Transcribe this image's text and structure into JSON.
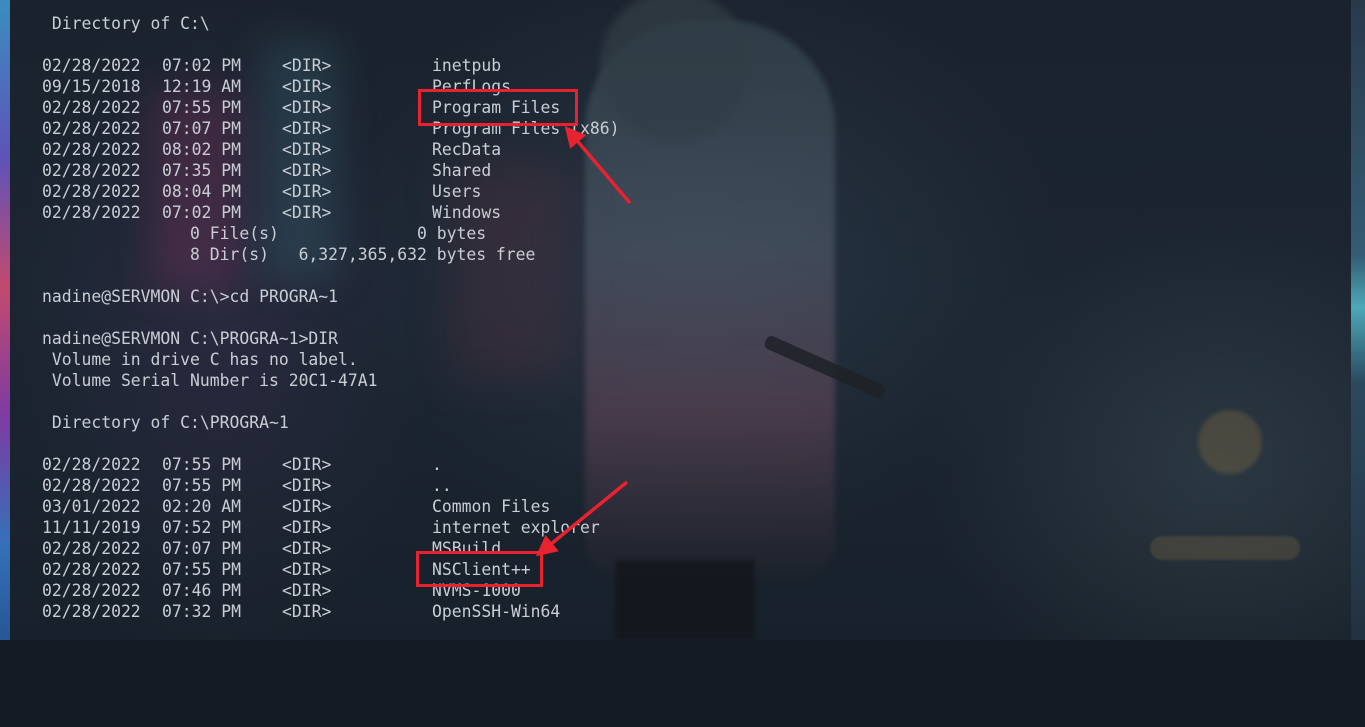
{
  "terminal": {
    "header1": " Directory of C:\\",
    "listing1": [
      {
        "date": "02/28/2022",
        "time": "07:02 PM",
        "type": "<DIR>",
        "name": "inetpub"
      },
      {
        "date": "09/15/2018",
        "time": "12:19 AM",
        "type": "<DIR>",
        "name": "PerfLogs"
      },
      {
        "date": "02/28/2022",
        "time": "07:55 PM",
        "type": "<DIR>",
        "name": "Program Files"
      },
      {
        "date": "02/28/2022",
        "time": "07:07 PM",
        "type": "<DIR>",
        "name": "Program Files (x86)"
      },
      {
        "date": "02/28/2022",
        "time": "08:02 PM",
        "type": "<DIR>",
        "name": "RecData"
      },
      {
        "date": "02/28/2022",
        "time": "07:35 PM",
        "type": "<DIR>",
        "name": "Shared"
      },
      {
        "date": "02/28/2022",
        "time": "08:04 PM",
        "type": "<DIR>",
        "name": "Users"
      },
      {
        "date": "02/28/2022",
        "time": "07:02 PM",
        "type": "<DIR>",
        "name": "Windows"
      }
    ],
    "summary_files": "               0 File(s)              0 bytes",
    "summary_dirs": "               8 Dir(s)   6,327,365,632 bytes free",
    "cmd1": "nadine@SERVMON C:\\>cd PROGRA~1",
    "cmd2": "nadine@SERVMON C:\\PROGRA~1>DIR",
    "volume_label": " Volume in drive C has no label.",
    "volume_serial": " Volume Serial Number is 20C1-47A1",
    "header2": " Directory of C:\\PROGRA~1",
    "listing2": [
      {
        "date": "02/28/2022",
        "time": "07:55 PM",
        "type": "<DIR>",
        "name": "."
      },
      {
        "date": "02/28/2022",
        "time": "07:55 PM",
        "type": "<DIR>",
        "name": ".."
      },
      {
        "date": "03/01/2022",
        "time": "02:20 AM",
        "type": "<DIR>",
        "name": "Common Files"
      },
      {
        "date": "11/11/2019",
        "time": "07:52 PM",
        "type": "<DIR>",
        "name": "internet explorer"
      },
      {
        "date": "02/28/2022",
        "time": "07:07 PM",
        "type": "<DIR>",
        "name": "MSBuild"
      },
      {
        "date": "02/28/2022",
        "time": "07:55 PM",
        "type": "<DIR>",
        "name": "NSClient++"
      },
      {
        "date": "02/28/2022",
        "time": "07:46 PM",
        "type": "<DIR>",
        "name": "NVMS-1000"
      },
      {
        "date": "02/28/2022",
        "time": "07:32 PM",
        "type": "<DIR>",
        "name": "OpenSSH-Win64"
      }
    ]
  },
  "annotations": {
    "color": "#e8222e",
    "highlighted": [
      "Program Files",
      "NSClient++"
    ]
  }
}
